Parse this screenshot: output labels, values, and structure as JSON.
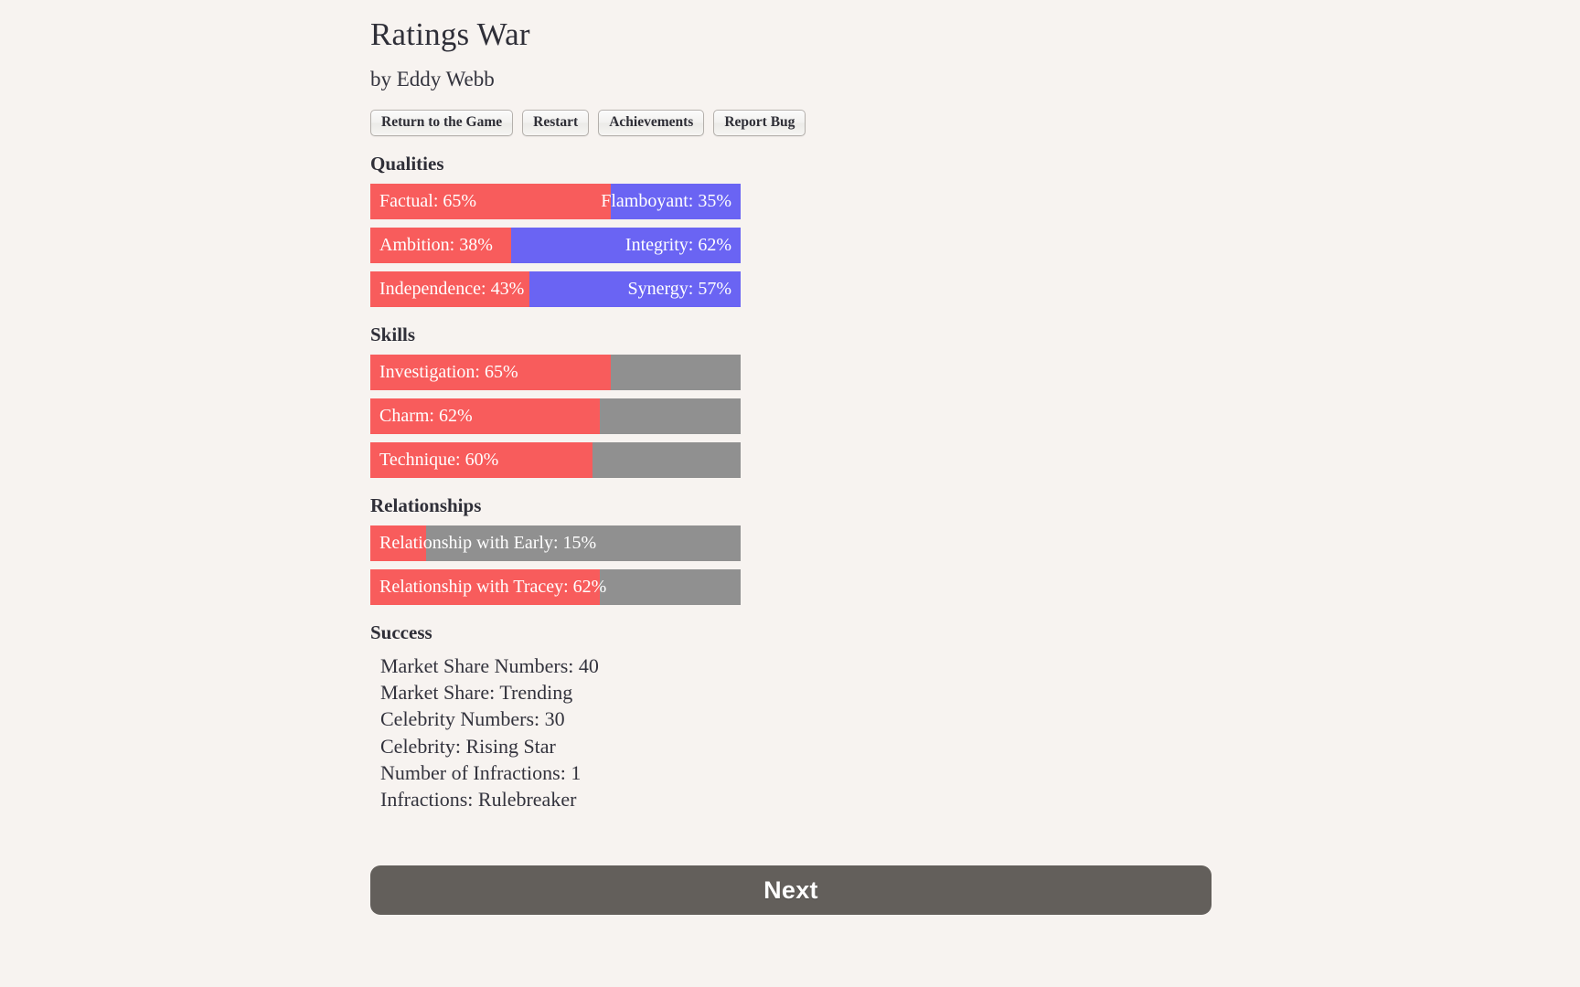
{
  "page": {
    "background_color": "#f7f3f0",
    "title": "Ratings War",
    "byline": "by Eddy Webb"
  },
  "toolbar": {
    "buttons": [
      {
        "label": "Return to the Game"
      },
      {
        "label": "Restart"
      },
      {
        "label": "Achievements"
      },
      {
        "label": "Report Bug"
      }
    ]
  },
  "colors": {
    "opposed_left": "#f85c5c",
    "opposed_right": "#6a64f3",
    "track": "#909090",
    "next_button": "#635f5b"
  },
  "sections": {
    "qualities": {
      "heading": "Qualities",
      "bars": [
        {
          "left_label": "Factual: 65%",
          "right_label": "Flamboyant: 35%",
          "left_percent": 65,
          "right_percent": 35,
          "type": "opposed"
        },
        {
          "left_label": "Ambition: 38%",
          "right_label": "Integrity: 62%",
          "left_percent": 38,
          "right_percent": 62,
          "type": "opposed"
        },
        {
          "left_label": "Independence: 43%",
          "right_label": "Synergy: 57%",
          "left_percent": 43,
          "right_percent": 57,
          "type": "opposed"
        }
      ]
    },
    "skills": {
      "heading": "Skills",
      "bars": [
        {
          "left_label": "Investigation: 65%",
          "right_label": "",
          "left_percent": 65,
          "type": "single"
        },
        {
          "left_label": "Charm: 62%",
          "right_label": "",
          "left_percent": 62,
          "type": "single"
        },
        {
          "left_label": "Technique: 60%",
          "right_label": "",
          "left_percent": 60,
          "type": "single"
        }
      ]
    },
    "relationships": {
      "heading": "Relationships",
      "bars": [
        {
          "left_label": "Relationship with Early: 15%",
          "right_label": "",
          "left_percent": 15,
          "type": "single"
        },
        {
          "left_label": "Relationship with Tracey: 62%",
          "right_label": "",
          "left_percent": 62,
          "type": "single"
        }
      ]
    },
    "success": {
      "heading": "Success",
      "items": [
        "Market Share Numbers: 40",
        "Market Share: Trending",
        "Celebrity Numbers: 30",
        "Celebrity: Rising Star",
        "Number of Infractions: 1",
        "Infractions: Rulebreaker"
      ]
    }
  },
  "footer": {
    "next_label": "Next"
  }
}
